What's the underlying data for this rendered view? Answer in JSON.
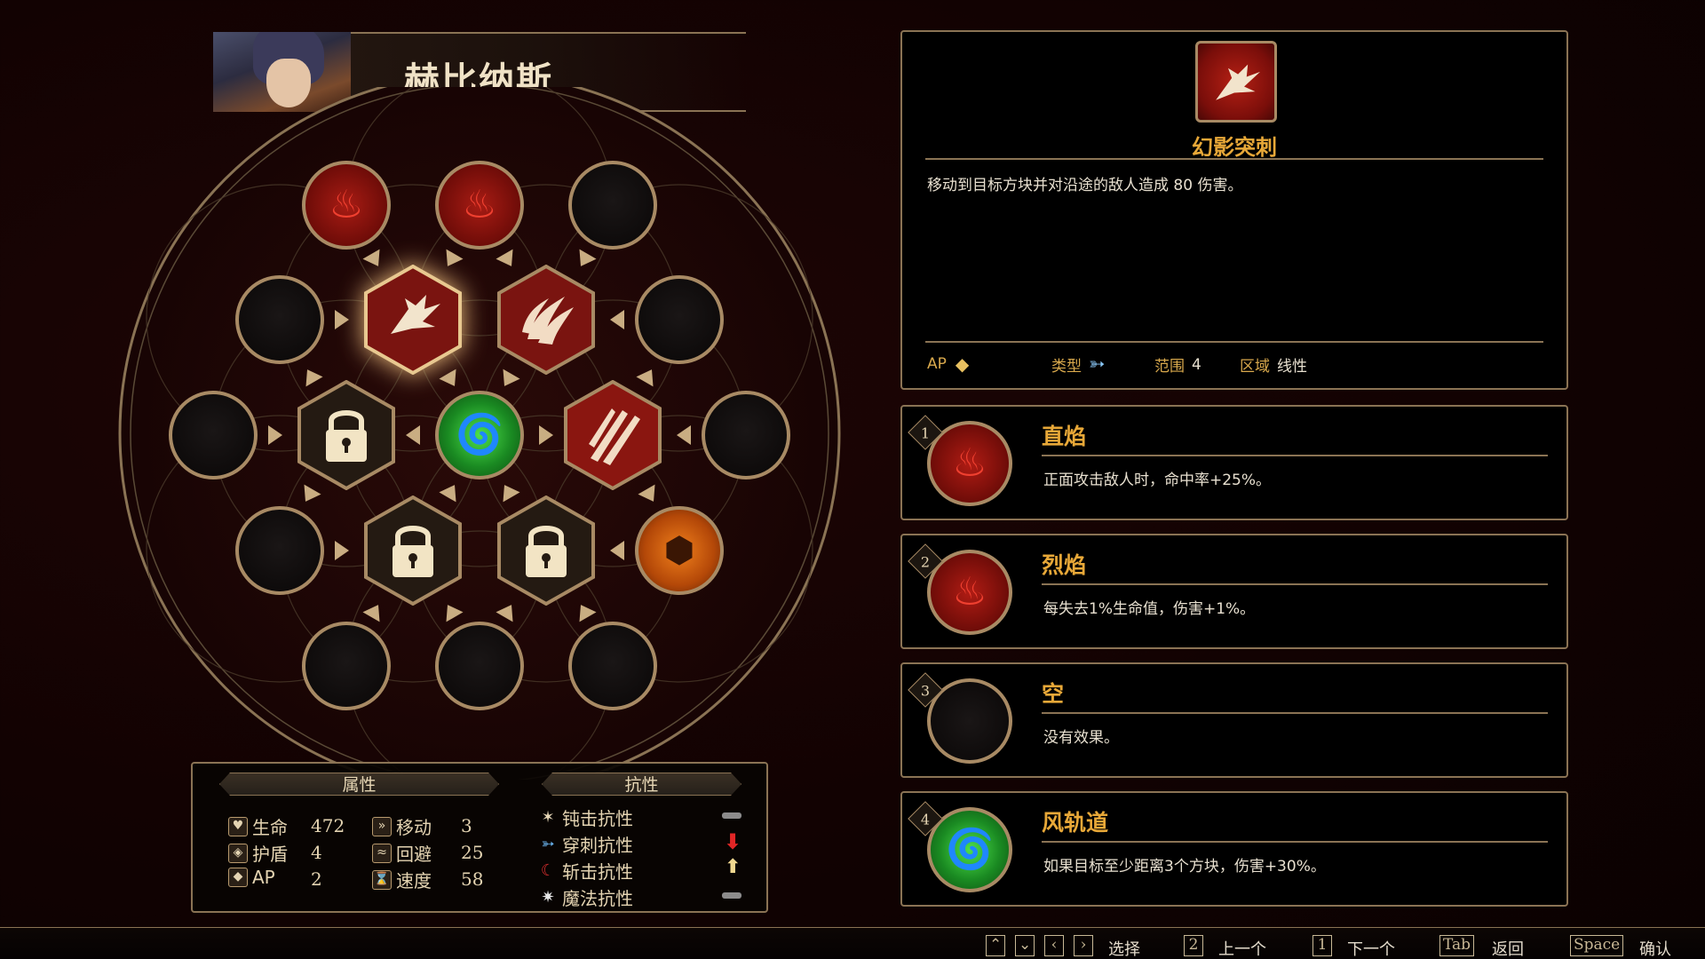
{
  "character": {
    "name": "赫比纳斯"
  },
  "wheel": {
    "nodes_row1": [
      "fire",
      "fire",
      "empty"
    ],
    "nodes_row2": [
      "empty",
      "phantom-thrust",
      "flame-claw",
      "empty"
    ],
    "nodes_row3": [
      "empty",
      "locked",
      "wind",
      "slash",
      "empty"
    ],
    "nodes_row4": [
      "empty",
      "locked",
      "locked",
      "earth"
    ],
    "nodes_row5": [
      "empty",
      "empty",
      "empty"
    ],
    "selected": "phantom-thrust"
  },
  "stats": {
    "attributes_tab": "属性",
    "resist_tab": "抗性",
    "attributes": [
      {
        "icon": "heart-icon",
        "glyph": "♥",
        "label": "生命",
        "value": "472"
      },
      {
        "icon": "shield-icon",
        "glyph": "◈",
        "label": "护盾",
        "value": "4"
      },
      {
        "icon": "ap-icon",
        "glyph": "◆",
        "label": "AP",
        "value": "2"
      },
      {
        "icon": "move-icon",
        "glyph": "»",
        "label": "移动",
        "value": "3"
      },
      {
        "icon": "evade-icon",
        "glyph": "≈",
        "label": "回避",
        "value": "25"
      },
      {
        "icon": "speed-icon",
        "glyph": "⌛",
        "label": "速度",
        "value": "58"
      }
    ],
    "resistances": [
      {
        "icon": "blunt-icon",
        "glyph": "✶",
        "label": "钝击抗性",
        "indicator": "neutral"
      },
      {
        "icon": "pierce-icon",
        "glyph": "➳",
        "label": "穿刺抗性",
        "indicator": "down"
      },
      {
        "icon": "slash-icon",
        "glyph": "☾",
        "label": "斩击抗性",
        "indicator": "up"
      },
      {
        "icon": "magic-icon",
        "glyph": "✷",
        "label": "魔法抗性",
        "indicator": "neutral"
      }
    ]
  },
  "detail": {
    "title": "幻影突刺",
    "description": "移动到目标方块并对沿途的敌人造成 80 伤害。",
    "ap_label": "AP",
    "type_label": "类型",
    "range_label": "范围",
    "range_value": "4",
    "area_label": "区域",
    "area_value": "线性"
  },
  "slots": [
    {
      "num": "1",
      "gem": "fire",
      "title": "直焰",
      "desc": "正面攻击敌人时，命中率+25%。"
    },
    {
      "num": "2",
      "gem": "fire",
      "title": "烈焰",
      "desc": "每失去1%生命值，伤害+1%。"
    },
    {
      "num": "3",
      "gem": "empty",
      "title": "空",
      "desc": "没有效果。"
    },
    {
      "num": "4",
      "gem": "wind",
      "title": "风轨道",
      "desc": "如果目标至少距离3个方块，伤害+30%。"
    }
  ],
  "hints": {
    "select_label": "选择",
    "prev_key": "2",
    "prev_label": "上一个",
    "next_key": "1",
    "next_label": "下一个",
    "back_key": "Tab",
    "back_label": "返回",
    "confirm_key": "Space",
    "confirm_label": "确认"
  },
  "colors": {
    "gold": "#a88a64",
    "title_orange": "#e8a838",
    "fire": "#a81c14",
    "wind": "#2ec62a",
    "earth": "#e07818"
  }
}
